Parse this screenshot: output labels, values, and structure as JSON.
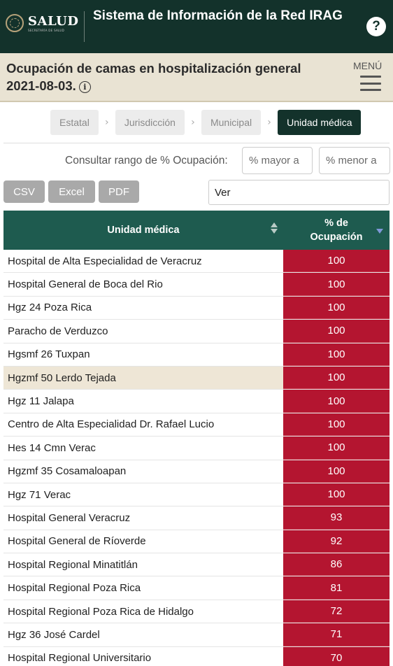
{
  "header": {
    "logo_text": "SALUD",
    "logo_subtext": "SECRETARÍA DE SALUD",
    "title": "Sistema de Información de la Red IRAG",
    "help_icon": "question-circle-icon",
    "help_label": "?"
  },
  "subheader": {
    "title": "Ocupación de camas en hospitalización general",
    "date": "2021-08-03.",
    "info_icon": "info-icon",
    "info_label": "i",
    "menu_label": "MENÚ",
    "menu_icon": "hamburger-icon"
  },
  "tabs": [
    {
      "label": "Estatal",
      "active": false
    },
    {
      "label": "Jurisdicción",
      "active": false
    },
    {
      "label": "Municipal",
      "active": false
    },
    {
      "label": "Unidad médica",
      "active": true
    }
  ],
  "tab_separator": "›",
  "range": {
    "label": "Consultar rango de % Ocupación:",
    "min_placeholder": "% mayor a",
    "max_placeholder": "% menor a"
  },
  "export": {
    "csv": "CSV",
    "excel": "Excel",
    "pdf": "PDF"
  },
  "search": {
    "value": "Ver"
  },
  "table": {
    "col_unit": "Unidad médica",
    "col_pct_line1": "% de",
    "col_pct_line2": "Ocupación",
    "rows": [
      {
        "unit": "Hospital de Alta Especialidad de Veracruz",
        "pct": "100"
      },
      {
        "unit": "Hospital General de Boca del Rio",
        "pct": "100"
      },
      {
        "unit": "Hgz 24 Poza Rica",
        "pct": "100"
      },
      {
        "unit": "Paracho de Verduzco",
        "pct": "100"
      },
      {
        "unit": "Hgsmf 26 Tuxpan",
        "pct": "100"
      },
      {
        "unit": "Hgzmf 50 Lerdo Tejada",
        "pct": "100"
      },
      {
        "unit": "Hgz 11 Jalapa",
        "pct": "100"
      },
      {
        "unit": "Centro de Alta Especialidad Dr. Rafael Lucio",
        "pct": "100"
      },
      {
        "unit": "Hes 14 Cmn Verac",
        "pct": "100"
      },
      {
        "unit": "Hgzmf 35 Cosamaloapan",
        "pct": "100"
      },
      {
        "unit": "Hgz 71 Verac",
        "pct": "100"
      },
      {
        "unit": "Hospital General Veracruz",
        "pct": "93"
      },
      {
        "unit": "Hospital General de Ríoverde",
        "pct": "92"
      },
      {
        "unit": "Hospital Regional Minatitlán",
        "pct": "86"
      },
      {
        "unit": "Hospital Regional Poza Rica",
        "pct": "81"
      },
      {
        "unit": "Hospital Regional Poza Rica de Hidalgo",
        "pct": "72"
      },
      {
        "unit": "Hgz 36 José Cardel",
        "pct": "71"
      },
      {
        "unit": "Hospital Regional Universitario",
        "pct": "70"
      }
    ]
  },
  "colors": {
    "header_bg": "#13322b",
    "subheader_bg": "#e9e3d3",
    "table_header_bg": "#1e5b4f",
    "occupancy_cell_bg": "#b41530",
    "highlight_row_bg": "#eee6d6"
  }
}
